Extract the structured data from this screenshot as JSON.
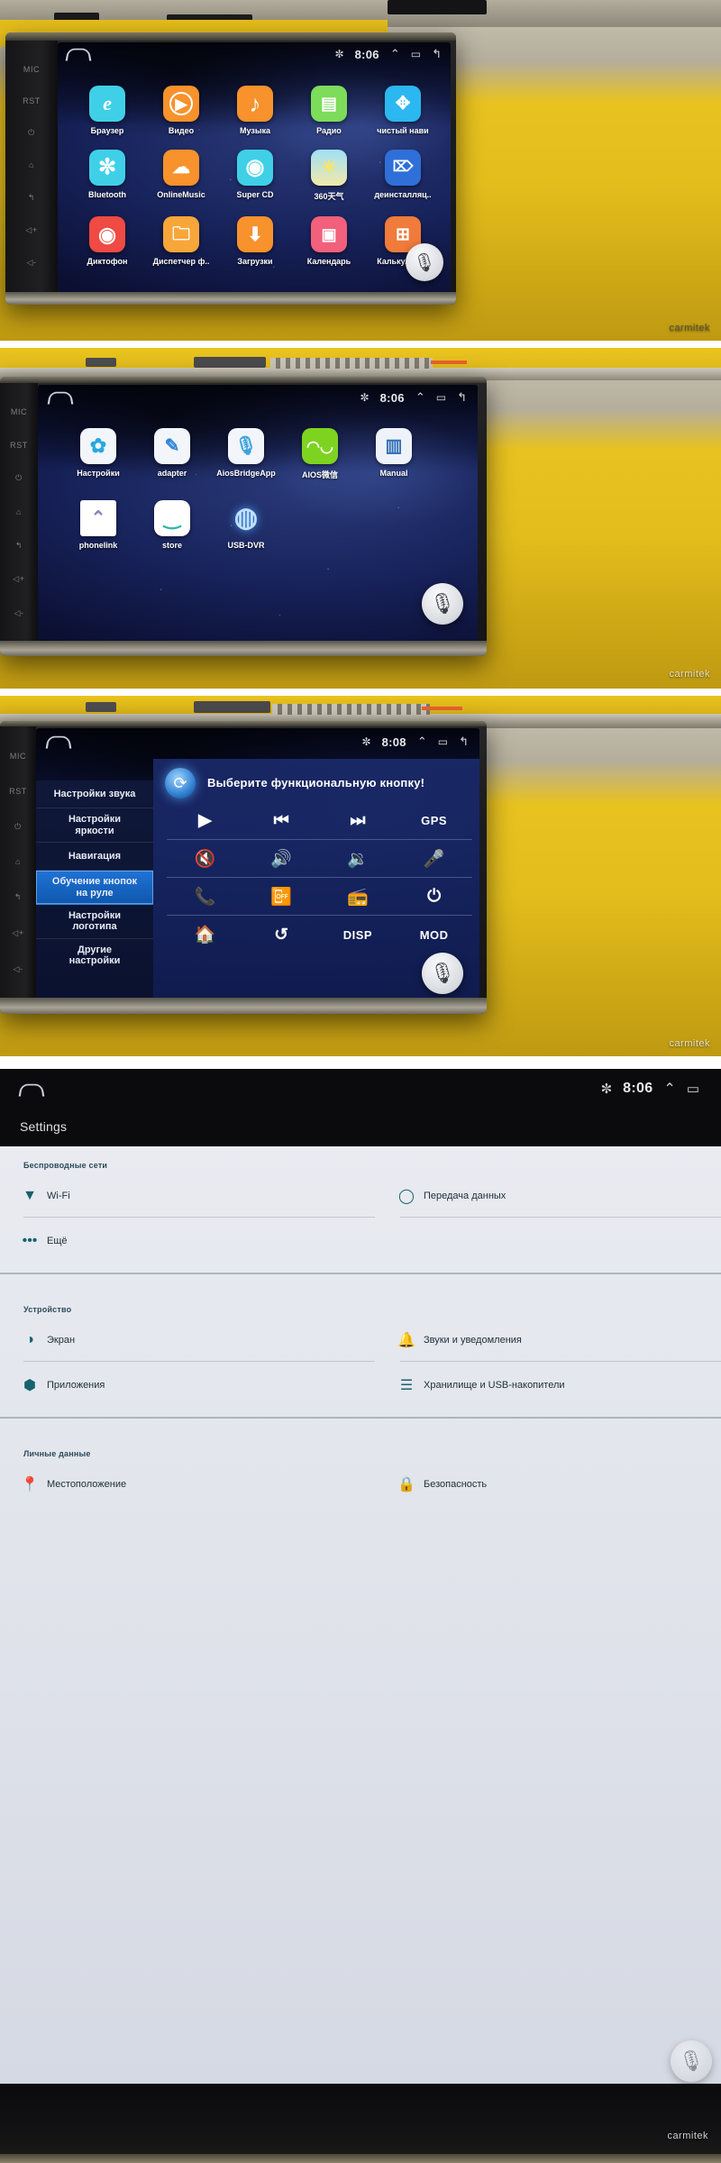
{
  "meta": {
    "watermark": "carmitek"
  },
  "panel1": {
    "name": "App drawer page 1",
    "statusbar": {
      "home_icon": "home-icon",
      "bluetooth_icon": "bluetooth-icon",
      "time": "8:06",
      "up_icon": "chevron-up-icon",
      "recents_icon": "recents-icon",
      "back_icon": "back-icon"
    },
    "apps": [
      {
        "label": "Браузер",
        "icon": "internet-explorer-icon",
        "glyph": "e",
        "color": "#3fd0e8"
      },
      {
        "label": "Видео",
        "icon": "play-circle-icon",
        "glyph": "▶",
        "color": "#f7922c"
      },
      {
        "label": "Музыка",
        "icon": "music-note-icon",
        "glyph": "♪",
        "color": "#f7922c"
      },
      {
        "label": "Радио",
        "icon": "radio-icon",
        "glyph": "▤",
        "color": "#7ddc5a"
      },
      {
        "label": "чистый нави",
        "icon": "compass-icon",
        "glyph": "✥",
        "color": "#2bb7f0"
      },
      {
        "label": "Bluetooth",
        "icon": "bluetooth-icon",
        "glyph": "✚",
        "color": "#3fd0e8"
      },
      {
        "label": "OnlineMusic",
        "icon": "cloud-music-icon",
        "glyph": "☁",
        "color": "#f7922c"
      },
      {
        "label": "Super CD",
        "icon": "disc-icon",
        "glyph": "◉",
        "color": "#3fd0e8"
      },
      {
        "label": "360天气",
        "icon": "weather-icon",
        "glyph": "☀",
        "color": "#8fd8f5"
      },
      {
        "label": "деинсталляц..",
        "icon": "uninstall-icon",
        "glyph": "⌦",
        "color": "#2f6fd8"
      },
      {
        "label": "Диктофон",
        "icon": "record-icon",
        "glyph": "◉",
        "color": "#ef4a43"
      },
      {
        "label": "Диспетчер ф..",
        "icon": "folder-icon",
        "glyph": "🗀",
        "color": "#f7a63a"
      },
      {
        "label": "Загрузки",
        "icon": "download-icon",
        "glyph": "⬇",
        "color": "#f7922c"
      },
      {
        "label": "Календарь",
        "icon": "calendar-icon",
        "glyph": "▣",
        "color": "#f2607c"
      },
      {
        "label": "Калькулятор",
        "icon": "calculator-globe-icon",
        "glyph": "⊞",
        "color": "#f07b3a"
      }
    ],
    "mic_icon": "microphone-icon"
  },
  "panel2": {
    "name": "App drawer page 2",
    "statusbar": {
      "home_icon": "home-icon",
      "bluetooth_icon": "bluetooth-icon",
      "time": "8:06",
      "up_icon": "chevron-up-icon",
      "recents_icon": "recents-icon",
      "back_icon": "back-icon"
    },
    "apps": [
      {
        "label": "Настройки",
        "icon": "settings-gear-icon",
        "glyph": "✿",
        "color": "#f4f6fa"
      },
      {
        "label": "adapter",
        "icon": "pencil-icon",
        "glyph": "✎",
        "color": "#f4f6fa"
      },
      {
        "label": "AiosBridgeApp",
        "icon": "microphone-icon",
        "glyph": "🎙",
        "color": "#f4f6fa"
      },
      {
        "label": "AIOS微信",
        "icon": "wechat-icon",
        "glyph": "◠◡",
        "color": "#7ed321"
      },
      {
        "label": "Manual",
        "icon": "book-icon",
        "glyph": "▥",
        "color": "#f4f6fa"
      },
      {
        "label": "phonelink",
        "icon": "mountain-icon",
        "glyph": "⌃",
        "color": "#ffffff"
      },
      {
        "label": "store",
        "icon": "smile-store-icon",
        "glyph": "‿",
        "color": "#ffffff"
      },
      {
        "label": "USB-DVR",
        "icon": "dvr-globe-icon",
        "glyph": "◍",
        "color": "#2a3f8a"
      }
    ],
    "mic_icon": "microphone-icon"
  },
  "panel3": {
    "name": "Steering wheel key learning",
    "statusbar": {
      "home_icon": "home-icon",
      "bluetooth_icon": "bluetooth-icon",
      "time": "8:08",
      "up_icon": "chevron-up-icon",
      "recents_icon": "recents-icon",
      "back_icon": "back-icon"
    },
    "menu": [
      {
        "label": "Настройки звука",
        "selected": false
      },
      {
        "label": "Настройки\nяркости",
        "selected": false
      },
      {
        "label": "Навигация",
        "selected": false
      },
      {
        "label": "Обучение кнопок\nна руле",
        "selected": true
      },
      {
        "label": "Настройки\nлоготипа",
        "selected": false
      },
      {
        "label": "Другие\nнастройки",
        "selected": false
      }
    ],
    "prompt": "Выберите функциональную кнопку!",
    "refresh_icon": "refresh-icon",
    "functions": [
      {
        "label": "▶",
        "icon": "play-icon",
        "text": false
      },
      {
        "label": "⏮",
        "icon": "previous-track-icon",
        "text": false
      },
      {
        "label": "⏭",
        "icon": "next-track-icon",
        "text": false
      },
      {
        "label": "GPS",
        "icon": "gps-label",
        "text": true
      },
      {
        "label": "🔇",
        "icon": "mute-icon",
        "text": false
      },
      {
        "label": "🔊",
        "icon": "volume-up-icon",
        "text": false
      },
      {
        "label": "🔉",
        "icon": "volume-down-icon",
        "text": false
      },
      {
        "label": "🎤",
        "icon": "microphone-icon",
        "text": false
      },
      {
        "label": "📞",
        "icon": "phone-answer-icon",
        "text": false
      },
      {
        "label": "📴",
        "icon": "phone-hangup-icon",
        "text": false
      },
      {
        "label": "📻",
        "icon": "radio-icon",
        "text": false
      },
      {
        "label": "⏻",
        "icon": "power-icon",
        "text": false
      },
      {
        "label": "🏠",
        "icon": "home-icon",
        "text": false
      },
      {
        "label": "↺",
        "icon": "back-icon",
        "text": false
      },
      {
        "label": "DISP",
        "icon": "disp-label",
        "text": true
      },
      {
        "label": "MOD",
        "icon": "mod-label",
        "text": true
      }
    ],
    "mic_icon": "microphone-icon"
  },
  "panel4": {
    "name": "Android Settings",
    "statusbar": {
      "home_icon": "home-icon",
      "bluetooth_icon": "bluetooth-icon",
      "time": "8:06",
      "up_icon": "chevron-up-icon",
      "recents_icon": "recents-icon"
    },
    "title": "Settings",
    "sections": [
      {
        "header": "Беспроводные сети",
        "rows": [
          {
            "left": {
              "label": "Wi-Fi",
              "icon": "wifi-icon"
            },
            "right": {
              "label": "Передача данных",
              "icon": "data-usage-icon"
            }
          },
          {
            "left": {
              "label": "Ещё",
              "icon": "more-icon"
            },
            "right": {
              "label": "",
              "icon": ""
            }
          }
        ]
      },
      {
        "header": "Устройство",
        "rows": [
          {
            "left": {
              "label": "Экран",
              "icon": "brightness-icon"
            },
            "right": {
              "label": "Звуки и уведомления",
              "icon": "bell-icon"
            }
          },
          {
            "left": {
              "label": "Приложения",
              "icon": "android-icon"
            },
            "right": {
              "label": "Хранилище и USB-накопители",
              "icon": "storage-icon"
            }
          }
        ]
      },
      {
        "header": "Личные данные",
        "rows": [
          {
            "left": {
              "label": "Местоположение",
              "icon": "location-pin-icon"
            },
            "right": {
              "label": "Безопасность",
              "icon": "lock-icon"
            }
          }
        ]
      }
    ],
    "mic_icon": "microphone-icon"
  }
}
